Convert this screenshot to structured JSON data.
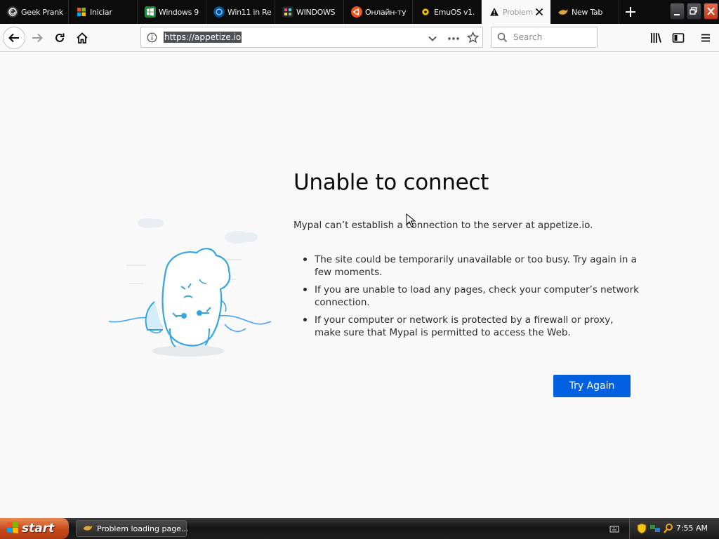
{
  "colors": {
    "accent": "#0060df",
    "tabbar": "#0c0c0d",
    "page_bg": "#f9f9fa",
    "start": "#c8481a"
  },
  "tabs": [
    {
      "label": "Geek Prank",
      "icon": "spiral-globe-icon",
      "active": false
    },
    {
      "label": "Iniciar",
      "icon": "windows-flag-icon",
      "active": false
    },
    {
      "label": "Windows 9",
      "icon": "green-windows-icon",
      "active": false
    },
    {
      "label": "Win11 in Re",
      "icon": "blue-circle-icon",
      "active": false
    },
    {
      "label": "WINDOWS",
      "icon": "dark-grid-icon",
      "active": false
    },
    {
      "label": "Онлайн-ту",
      "icon": "ubuntu-icon",
      "active": false
    },
    {
      "label": "EmuOS v1.",
      "icon": "yellow-gear-icon",
      "active": false
    },
    {
      "label": "Problem",
      "icon": "warning-icon",
      "active": true
    },
    {
      "label": "New Tab",
      "icon": "bird-icon",
      "active": false
    }
  ],
  "navbar": {
    "url": "https://appetize.io",
    "search_placeholder": "Search"
  },
  "error": {
    "title": "Unable to connect",
    "description": "Mypal can’t establish a connection to the server at appetize.io.",
    "bullets": [
      "The site could be temporarily unavailable or too busy. Try again in a few moments.",
      "If you are unable to load any pages, check your computer’s network connection.",
      "If your computer or network is protected by a firewall or proxy, make sure that Mypal is permitted to access the Web."
    ],
    "button": "Try Again"
  },
  "taskbar": {
    "start_label": "start",
    "task_label": "Problem loading page...",
    "clock": "7:55 AM"
  }
}
